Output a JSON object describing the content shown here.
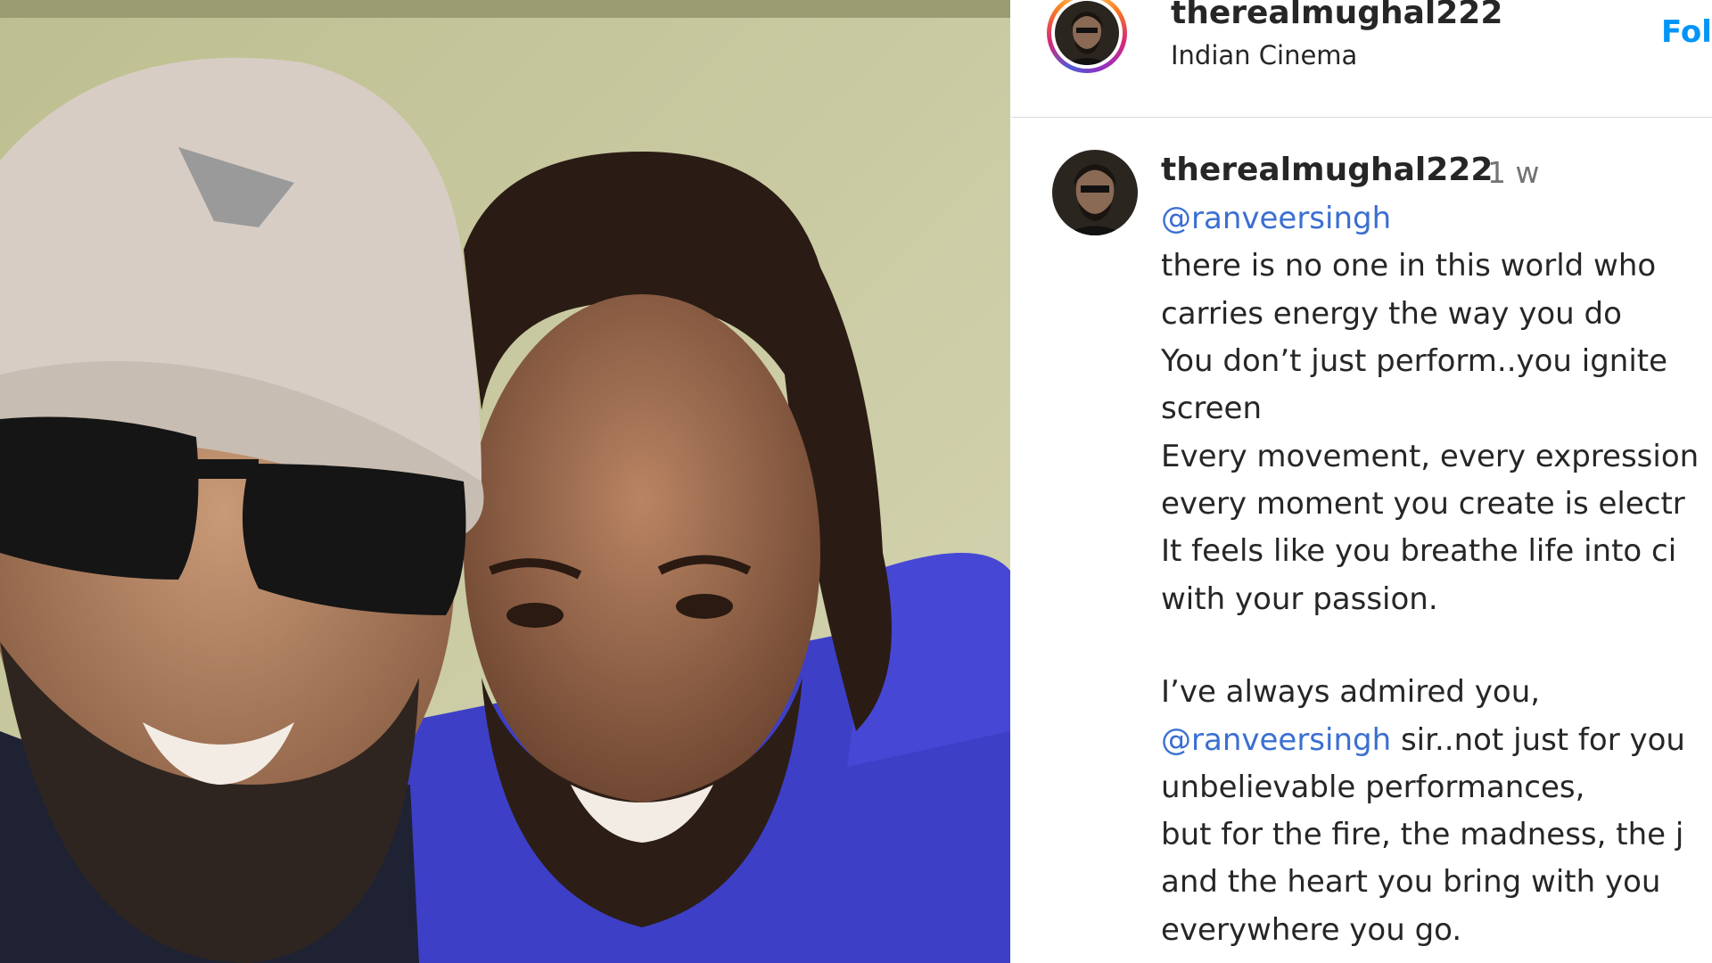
{
  "header": {
    "username": "therealmughal222",
    "subtitle": "Indian Cinema",
    "follow_label": "Fol"
  },
  "comment": {
    "username": "therealmughal222",
    "time": "1 w",
    "lines": [
      {
        "mention": "@ranveersingh",
        "text": ""
      },
      {
        "mention": "",
        "text": "there is no one in this world who"
      },
      {
        "mention": "",
        "text": "carries energy the way you do"
      },
      {
        "mention": "",
        "text": "You don’t just perform..you ignite"
      },
      {
        "mention": "",
        "text": "screen"
      },
      {
        "mention": "",
        "text": "Every movement, every expression"
      },
      {
        "mention": "",
        "text": "every moment you create is electr"
      },
      {
        "mention": "",
        "text": "It feels like you breathe life into ci"
      },
      {
        "mention": "",
        "text": "with your passion."
      },
      {
        "mention": "",
        "text": "I’ve always admired you,"
      },
      {
        "mention": "@ranveersingh",
        "text": " sir..not just for you"
      },
      {
        "mention": "",
        "text": "unbelievable performances,"
      },
      {
        "mention": "",
        "text": "but for the fire, the madness, the j"
      },
      {
        "mention": "",
        "text": "and the heart you bring with you"
      },
      {
        "mention": "",
        "text": "everywhere you go."
      }
    ]
  },
  "colors": {
    "link": "#3b6fd1",
    "follow": "#0095f6",
    "text": "#262626",
    "muted": "#737373"
  },
  "photo": {
    "icon": "post-photo"
  }
}
